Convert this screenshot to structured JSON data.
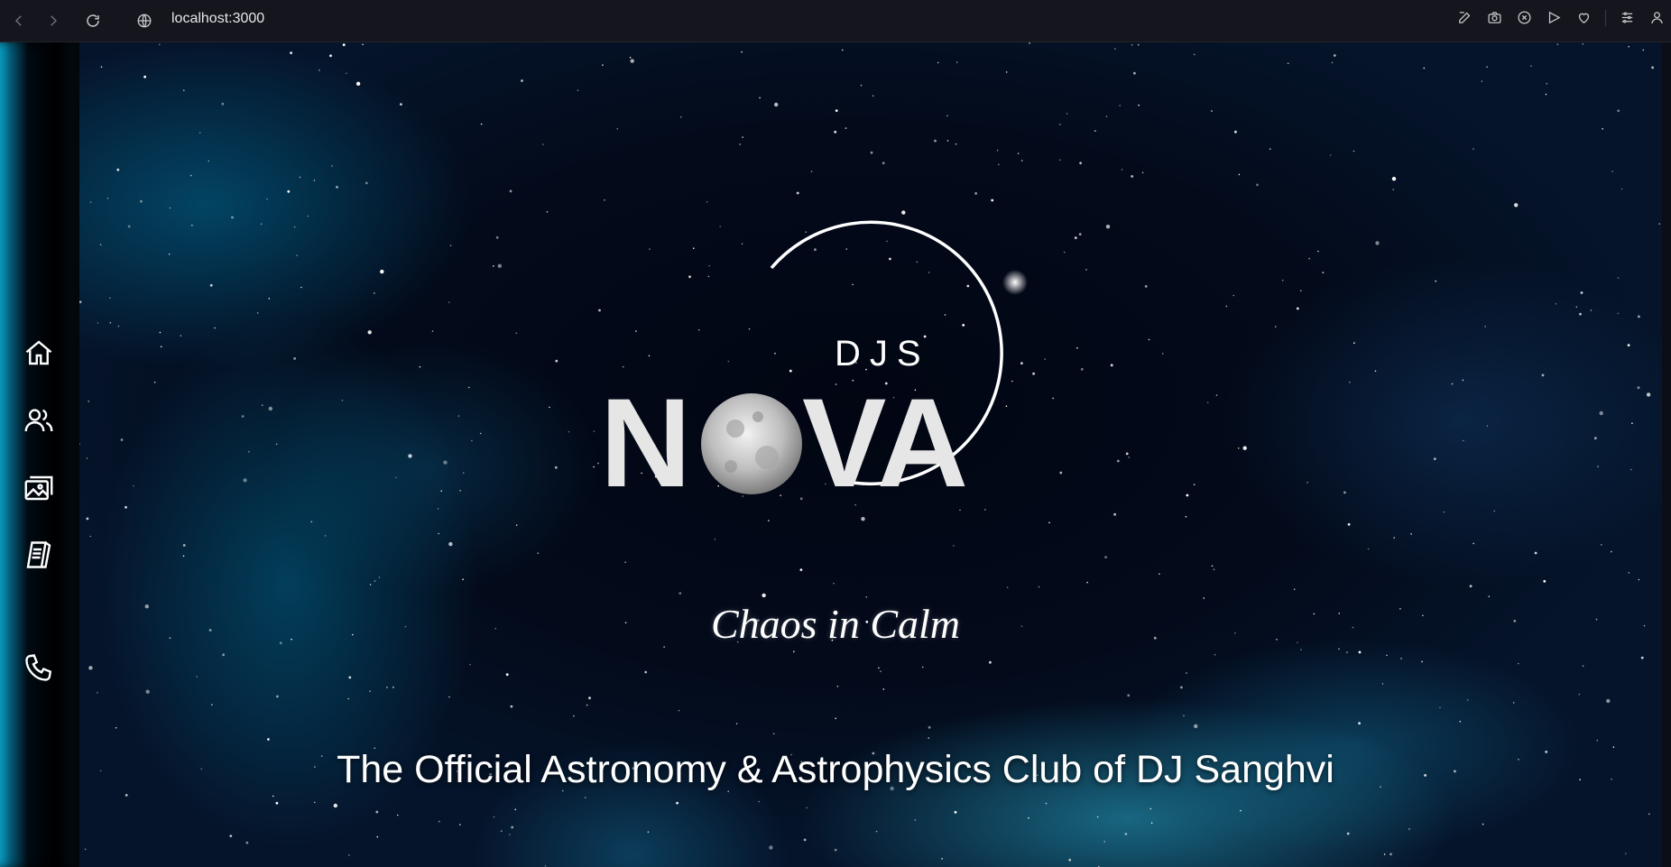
{
  "browser": {
    "url": "localhost:3000",
    "toolbar_icons": [
      "edit-icon",
      "camera-icon",
      "shield-x-icon",
      "send-icon",
      "heart-icon",
      "settings-sliders-icon",
      "profile-icon"
    ]
  },
  "sidebar": {
    "items": [
      {
        "name": "home",
        "icon": "home-icon"
      },
      {
        "name": "members",
        "icon": "users-icon"
      },
      {
        "name": "gallery",
        "icon": "gallery-icon"
      },
      {
        "name": "blogs",
        "icon": "blog-icon"
      },
      {
        "name": "contact",
        "icon": "phone-icon"
      }
    ]
  },
  "hero": {
    "logo_top": "DJS",
    "logo_main_left": "N",
    "logo_main_right": "VA",
    "tagline": "Chaos in Calm",
    "subtitle": "The Official Astronomy & Astrophysics Club of DJ Sanghvi"
  },
  "colors": {
    "background": "#05070f",
    "accent": "#0a9fc4",
    "text": "#ffffff"
  }
}
